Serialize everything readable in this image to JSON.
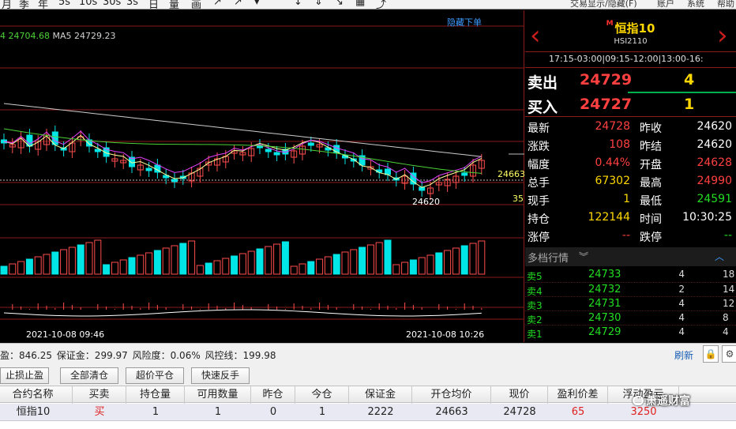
{
  "toolbar": {
    "items": [
      "月",
      "季",
      "年",
      "5s",
      "10s",
      "30s",
      "3s",
      "日",
      "量",
      "画",
      "↗",
      "↗",
      "▾",
      "↓",
      "⇓",
      "↘",
      "▦",
      "⤴"
    ],
    "menus": [
      "交易显示/隐藏(F)",
      "账户",
      "系统",
      "帮助"
    ]
  },
  "chart": {
    "hide_lower": "隐藏下单",
    "ma_prefix": "4",
    "ma4_value": "24704.68",
    "ma5_label": "MA5",
    "ma5_value": "24729.23",
    "time_left": "2021-10-08 09:46",
    "time_right": "2021-10-08 10:26",
    "low_label": "24620",
    "ref_label": "24663",
    "small_label": "35",
    "colors": {
      "up": "#ff4d4d",
      "down": "#00e5e5",
      "ma4": "#ffff99",
      "ma5": "#e040fb",
      "ma20": "#4cd137",
      "ma60": "#cccccc",
      "volume_up": "#ff4d4d",
      "volume_down": "#00e5e5"
    }
  },
  "quote": {
    "badge": "M",
    "name": "恒指10",
    "code": "HSI2110",
    "sessions": "17:15-03:00|09:15-12:00|13:00-16:",
    "sell_label": "卖出",
    "sell_price": "24729",
    "sell_vol": "4",
    "buy_label": "买入",
    "buy_price": "24727",
    "buy_vol": "1",
    "fields_left": [
      {
        "label": "最新",
        "value": "24728",
        "color": "r"
      },
      {
        "label": "涨跌",
        "value": "108",
        "color": "r"
      },
      {
        "label": "幅度",
        "value": "0.44%",
        "color": "r"
      },
      {
        "label": "总手",
        "value": "67302",
        "color": "y"
      },
      {
        "label": "现手",
        "value": "1",
        "color": "y"
      },
      {
        "label": "持仓",
        "value": "122144",
        "color": "y"
      },
      {
        "label": "涨停",
        "value": "--",
        "color": "r"
      }
    ],
    "fields_right": [
      {
        "label": "昨收",
        "value": "24620",
        "color": "w"
      },
      {
        "label": "昨结",
        "value": "24620",
        "color": "w"
      },
      {
        "label": "开盘",
        "value": "24628",
        "color": "r"
      },
      {
        "label": "最高",
        "value": "24990",
        "color": "r"
      },
      {
        "label": "最低",
        "value": "24591",
        "color": "g2"
      },
      {
        "label": "时间",
        "value": "10:30:25",
        "color": "w"
      },
      {
        "label": "跌停",
        "value": "--",
        "color": "g2"
      }
    ],
    "depth_title": "多档行情",
    "depth": [
      {
        "label": "卖5",
        "price": "24733",
        "vol": "4",
        "extra": "18"
      },
      {
        "label": "卖4",
        "price": "24732",
        "vol": "2",
        "extra": "14"
      },
      {
        "label": "卖3",
        "price": "24731",
        "vol": "4",
        "extra": "12"
      },
      {
        "label": "卖2",
        "price": "24730",
        "vol": "4",
        "extra": "8"
      },
      {
        "label": "卖1",
        "price": "24729",
        "vol": "4",
        "extra": "4"
      }
    ]
  },
  "account": {
    "text": "盈：846.25   保证金：299.97   风险度：0.06%   风控线：199.98",
    "refresh": "刷新"
  },
  "buttons": [
    "止损止盈",
    "全部清仓",
    "超价平仓",
    "快速反手"
  ],
  "table": {
    "headers": [
      "合约名称",
      "买卖",
      "持仓量",
      "可用数量",
      "昨仓",
      "今仓",
      "保证金",
      "开仓均价",
      "现价",
      "盈利价差",
      "浮动盈亏"
    ],
    "row": [
      "恒指10",
      "买",
      "1",
      "1",
      "0",
      "1",
      "2222",
      "24663",
      "24728",
      "65",
      "3250"
    ]
  },
  "watermark": "萧遥财富"
}
